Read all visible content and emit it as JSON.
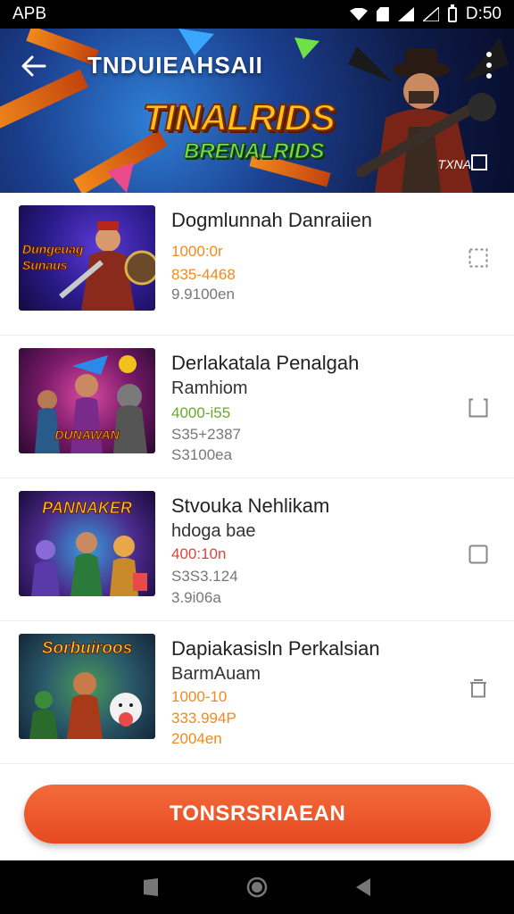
{
  "status_bar": {
    "left_text": "APB",
    "time": "D:50"
  },
  "header": {
    "title": "TNDUIEAHSAII",
    "logo_main": "TINALRIDS",
    "logo_sub": "BRENALRIDS",
    "overlay_text": "TXNA"
  },
  "items": [
    {
      "thumb_title": "Dungeuag Sunaus",
      "title": "Dogmlunnah Danraiien",
      "lines": [
        "1000:0r",
        "835-4468",
        "9.9100en"
      ],
      "checkbox": "dotted"
    },
    {
      "thumb_title": "DUNAWAN",
      "title": "Derlakatala Penalgah",
      "subtitle": "Ramhiom",
      "lines": [
        "4000-i55",
        "S35+2387",
        "S3100ea"
      ],
      "checkbox": "open"
    },
    {
      "thumb_title": "PANNAKER",
      "title": "Stvouka Nehlikam",
      "subtitle": "hdoga bae",
      "lines": [
        "400:10n",
        "S3S3.124",
        "3.9i06a"
      ],
      "checkbox": "closed"
    },
    {
      "thumb_title": "Sorbuiroos",
      "title": "Dapiakasisln Perkalsian",
      "subtitle": "BarmAuam",
      "lines": [
        "1000-10",
        "333.994P",
        "2004en"
      ],
      "checkbox": "trash"
    }
  ],
  "cta_label": "TONSRSRIAEAN",
  "colors": {
    "accent": "#e9552a",
    "price_orange": "#f08a1e",
    "price_green": "#6aa82a",
    "price_red": "#e0443a"
  }
}
